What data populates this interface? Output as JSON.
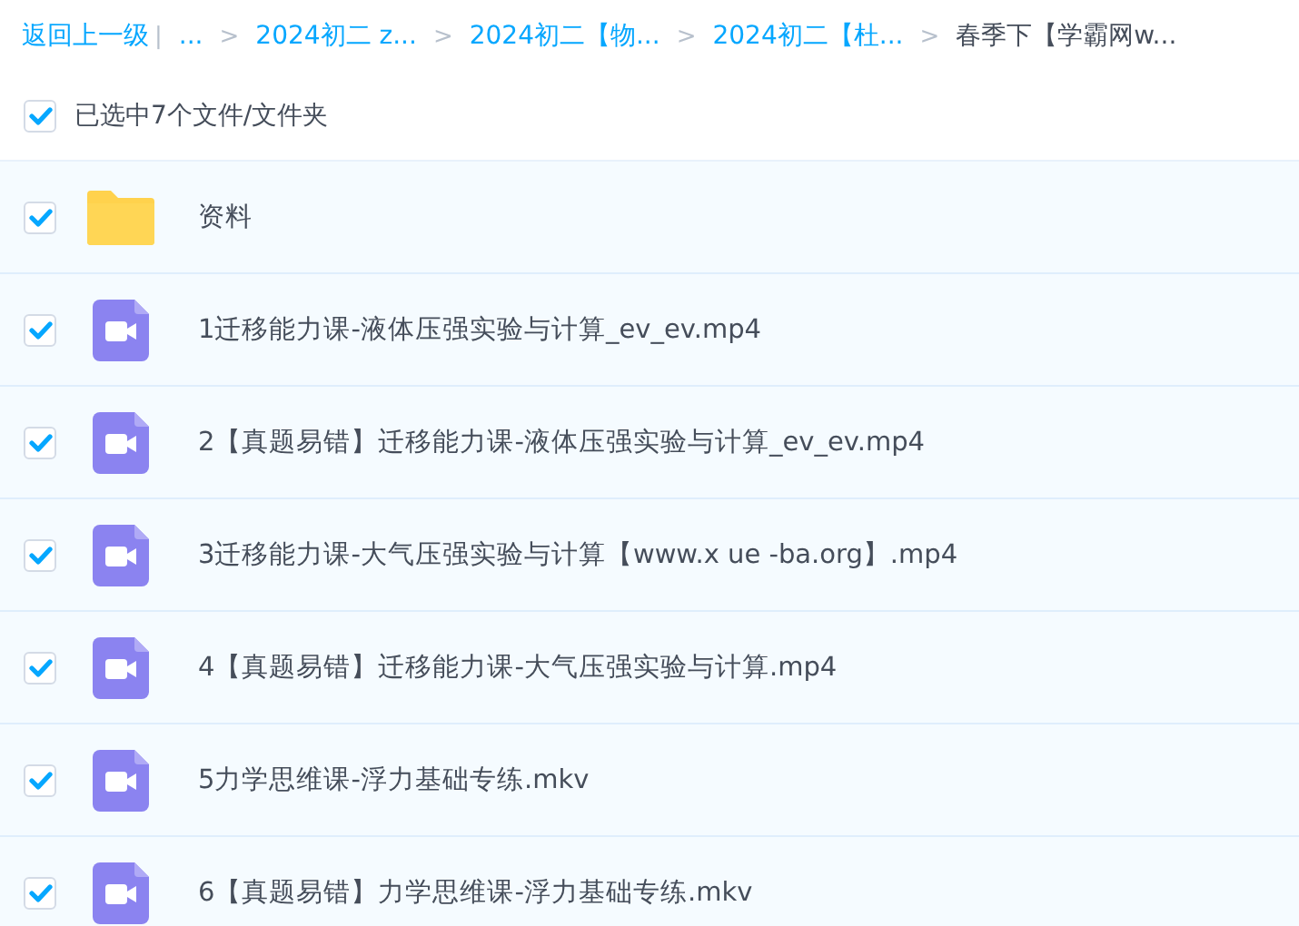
{
  "breadcrumb": {
    "back": "返回上一级",
    "divider": "|",
    "separator": ">",
    "items": [
      {
        "label": "...",
        "current": false
      },
      {
        "label": "2024初二 z...",
        "current": false
      },
      {
        "label": "2024初二【物...",
        "current": false
      },
      {
        "label": "2024初二【杜...",
        "current": false
      },
      {
        "label": "春季下【学霸网w...",
        "current": true
      }
    ]
  },
  "selection": {
    "checked": true,
    "text": "已选中7个文件/文件夹"
  },
  "files": [
    {
      "kind": "folder",
      "name": "资料",
      "checked": true
    },
    {
      "kind": "video",
      "name": "1迁移能力课-液体压强实验与计算_ev_ev.mp4",
      "checked": true
    },
    {
      "kind": "video",
      "name": "2【真题易错】迁移能力课-液体压强实验与计算_ev_ev.mp4",
      "checked": true
    },
    {
      "kind": "video",
      "name": "3迁移能力课-大气压强实验与计算【www.x ue -ba.org】.mp4",
      "checked": true
    },
    {
      "kind": "video",
      "name": "4【真题易错】迁移能力课-大气压强实验与计算.mp4",
      "checked": true
    },
    {
      "kind": "video",
      "name": "5力学思维课-浮力基础专练.mkv",
      "checked": true
    },
    {
      "kind": "video",
      "name": "6【真题易错】力学思维课-浮力基础专练.mkv",
      "checked": true
    }
  ]
}
